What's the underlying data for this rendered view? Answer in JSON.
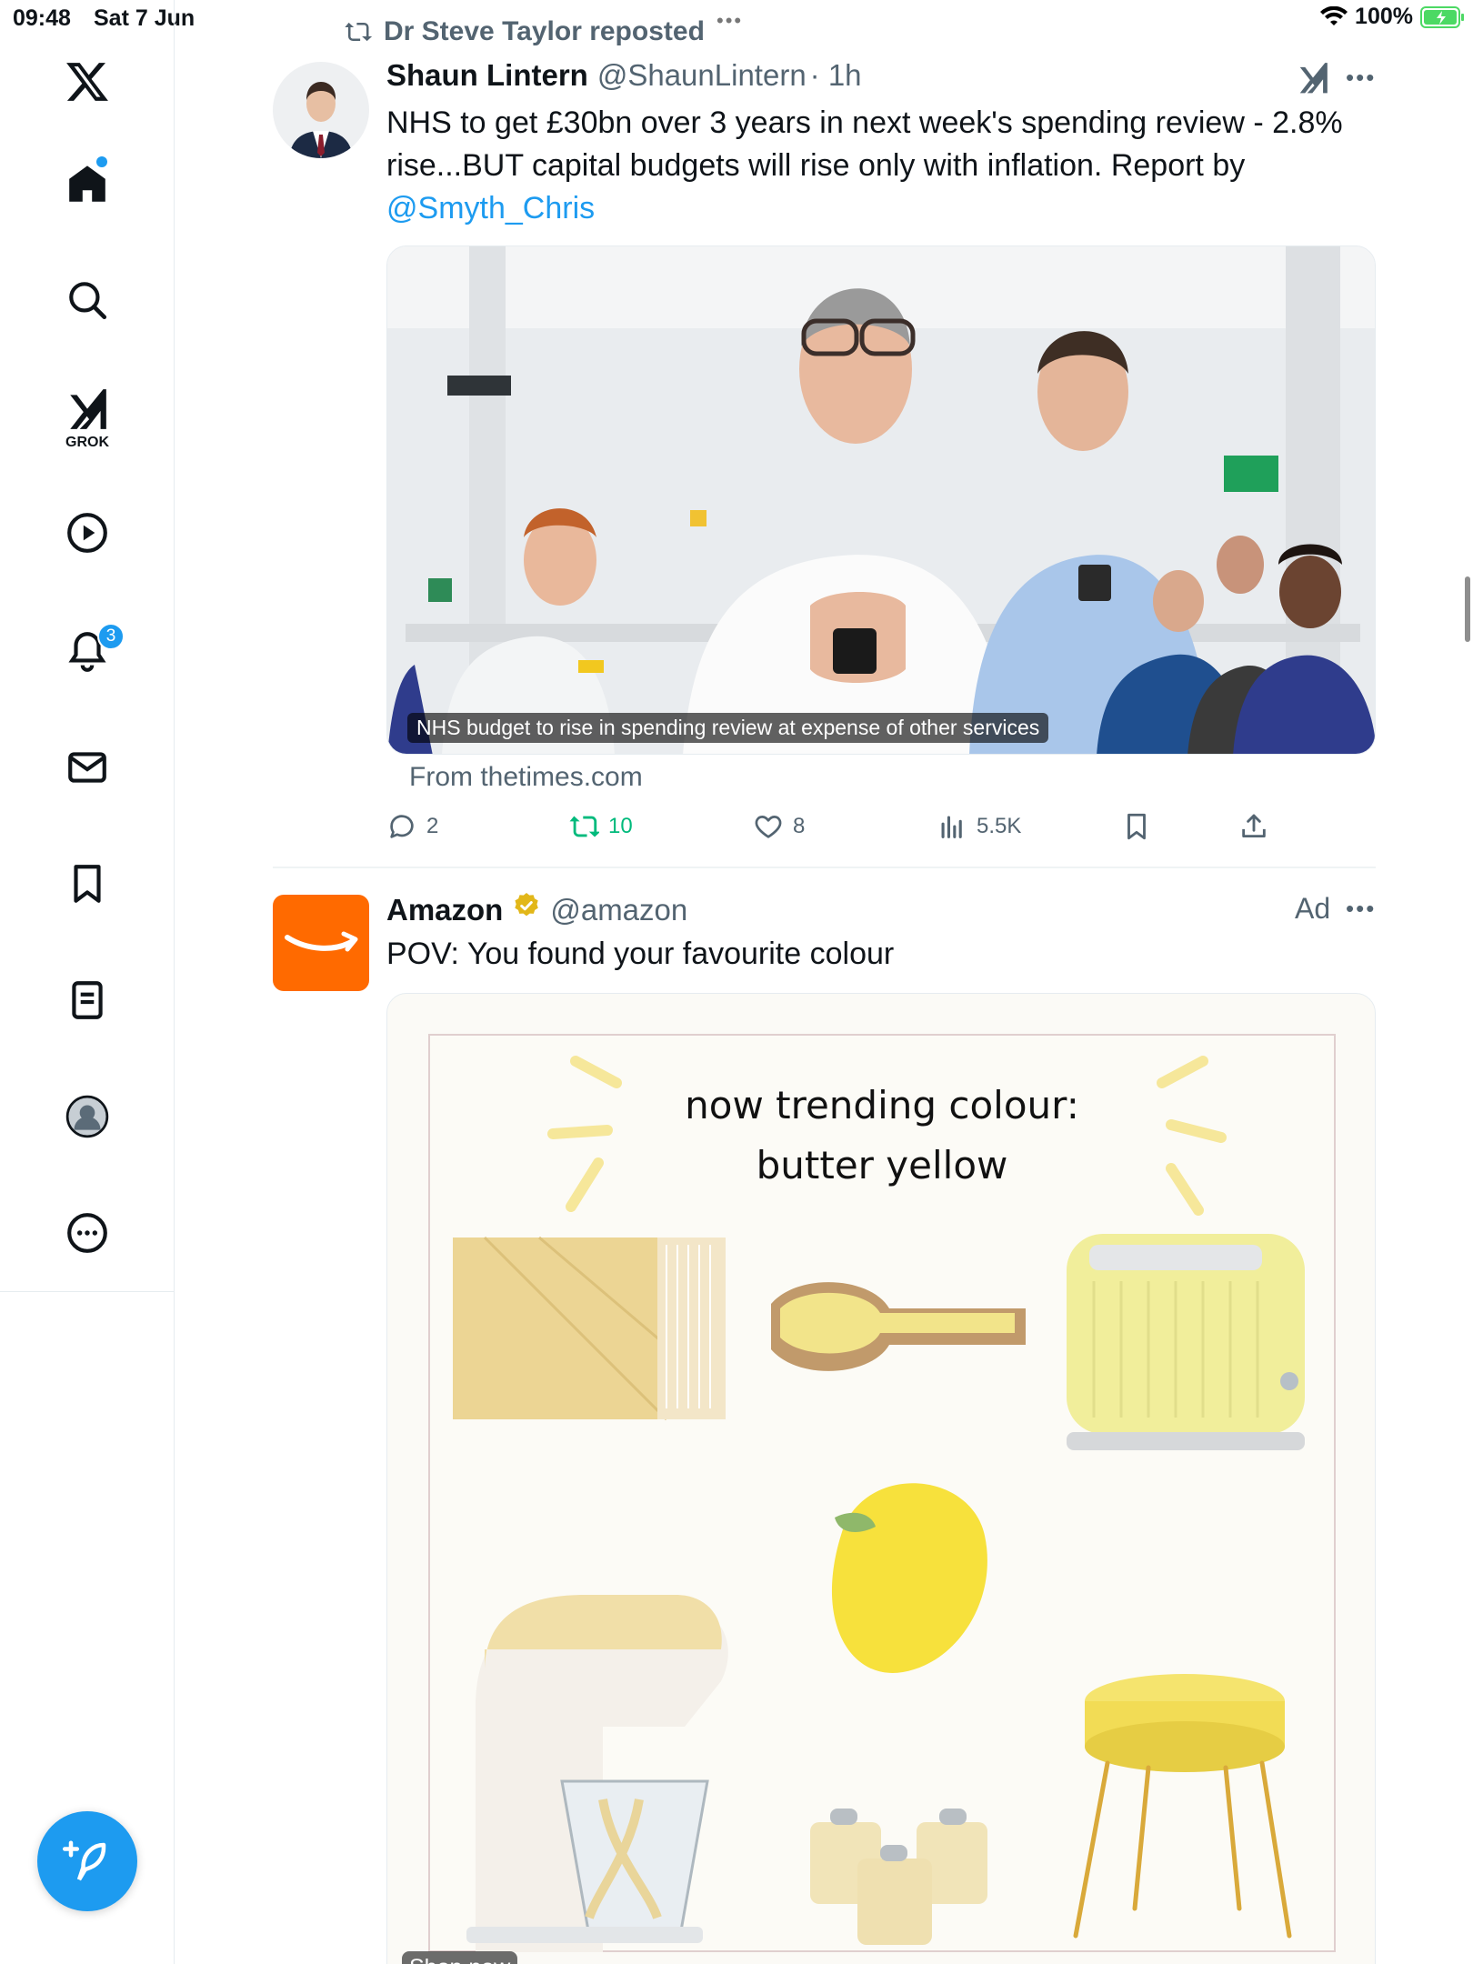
{
  "status_bar": {
    "time": "09:48",
    "date": "Sat 7 Jun",
    "battery": "100%"
  },
  "sidebar": {
    "items": [
      {
        "name": "home",
        "label": ""
      },
      {
        "name": "search",
        "label": ""
      },
      {
        "name": "grok",
        "label": "GROK"
      },
      {
        "name": "video",
        "label": ""
      },
      {
        "name": "notifications",
        "label": "",
        "badge": "3"
      },
      {
        "name": "messages",
        "label": ""
      },
      {
        "name": "bookmarks",
        "label": ""
      },
      {
        "name": "lists",
        "label": ""
      },
      {
        "name": "profile",
        "label": ""
      },
      {
        "name": "more",
        "label": ""
      }
    ]
  },
  "tweet1": {
    "repost_by": "Dr Steve Taylor reposted",
    "author_name": "Shaun Lintern",
    "handle": "@ShaunLintern",
    "time": "· 1h",
    "text_line1": "NHS to get £30bn over 3 years in next week's spending review - 2.8%",
    "text_line2": "rise...BUT capital budgets will rise only with inflation. Report by",
    "mention": "@Smyth_Chris",
    "card_caption": "NHS budget to rise in spending review at expense of other services",
    "card_source": "From thetimes.com",
    "replies": "2",
    "reposts": "10",
    "likes": "8",
    "views": "5.5K"
  },
  "tweet2": {
    "author_name": "Amazon",
    "handle": "@amazon",
    "ad_label": "Ad",
    "text": "POV: You found your favourite colour",
    "image_title_line1": "now trending colour:",
    "image_title_line2": "butter yellow",
    "cta": "Shop now"
  },
  "colors": {
    "accent": "#1d9bf0",
    "repost_green": "#00ba7c",
    "amazon_orange": "#ff6a00",
    "butter_yellow": "#f3e58a"
  }
}
